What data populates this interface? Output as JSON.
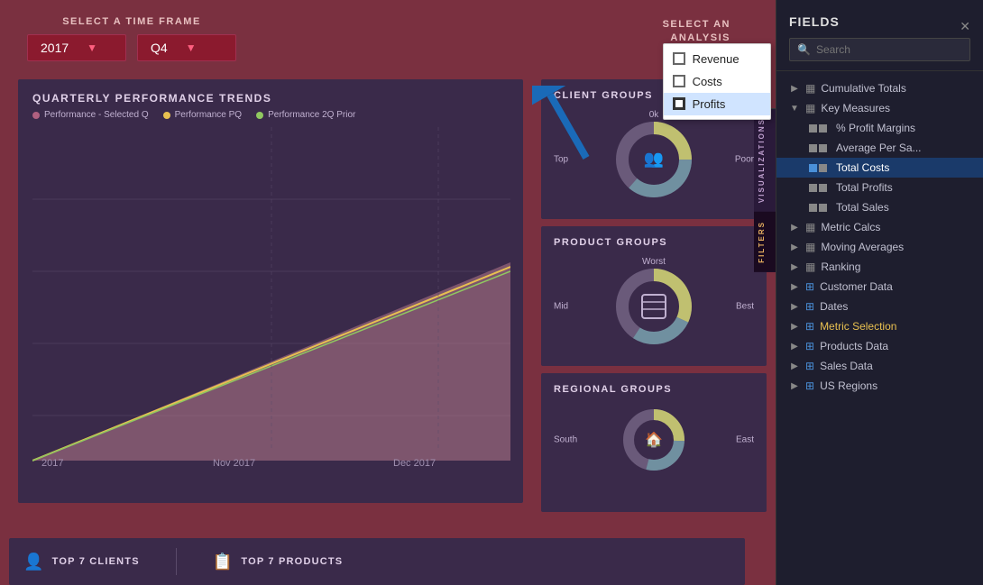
{
  "main": {
    "time_frame_label": "SELECT A TIME FRAME",
    "year_value": "2017",
    "quarter_value": "Q4",
    "metric_label": "SELECT AN\nANALYSIS\nMETRIC",
    "metric_options": [
      {
        "label": "Revenue",
        "checked": false
      },
      {
        "label": "Costs",
        "checked": false
      },
      {
        "label": "Profits",
        "checked": true
      }
    ]
  },
  "charts": {
    "quarterly_title": "QUARTERLY PERFORMANCE TRENDS",
    "legend": [
      {
        "label": "Performance - Selected Q",
        "color": "#b06080"
      },
      {
        "label": "Performance PQ",
        "color": "#e8c050"
      },
      {
        "label": "Performance 2Q Prior",
        "color": "#90c860"
      }
    ],
    "x_labels": [
      "2017",
      "Nov 2017",
      "Dec 2017"
    ],
    "client_groups_title": "CLIENT GROUPS",
    "client_labels": {
      "top": "0k",
      "right": "Poor",
      "left": "Top"
    },
    "product_groups_title": "PRODUCT GROUPS",
    "product_labels": {
      "top": "Worst",
      "right": "Best",
      "left": "Mid"
    },
    "regional_groups_title": "REGIONAL GROUPS",
    "regional_labels": {
      "left": "South",
      "right": "East"
    }
  },
  "bottom": {
    "clients_label": "TOP 7 CLIENTS",
    "products_label": "TOP 7 PRODUCTS"
  },
  "viz_tab": "VISUALIZATIONS",
  "filters_tab": "FILTERS",
  "sidebar": {
    "title": "FIELDS",
    "search_placeholder": "Search",
    "tree": [
      {
        "label": "Cumulative Totals",
        "expanded": false,
        "icon": "table",
        "type": "group"
      },
      {
        "label": "Key Measures",
        "expanded": true,
        "icon": "table",
        "type": "group",
        "children": [
          {
            "label": "% Profit Margins",
            "selected": false
          },
          {
            "label": "Average Per Sa...",
            "selected": false
          },
          {
            "label": "Total Costs",
            "selected": true
          },
          {
            "label": "Total Profits",
            "selected": false
          },
          {
            "label": "Total Sales",
            "selected": false
          }
        ]
      },
      {
        "label": "Metric Calcs",
        "icon": "table",
        "type": "group"
      },
      {
        "label": "Moving Averages",
        "icon": "table",
        "type": "group"
      },
      {
        "label": "Ranking",
        "icon": "table",
        "type": "group"
      },
      {
        "label": "Customer Data",
        "icon": "table-blue",
        "type": "group"
      },
      {
        "label": "Dates",
        "icon": "table-blue",
        "type": "group"
      },
      {
        "label": "Metric Selection",
        "icon": "table-blue",
        "type": "group",
        "yellow": true
      },
      {
        "label": "Products Data",
        "icon": "table-blue",
        "type": "group"
      },
      {
        "label": "Sales Data",
        "icon": "table-blue",
        "type": "group"
      },
      {
        "label": "US Regions",
        "icon": "table-blue",
        "type": "group"
      }
    ]
  }
}
